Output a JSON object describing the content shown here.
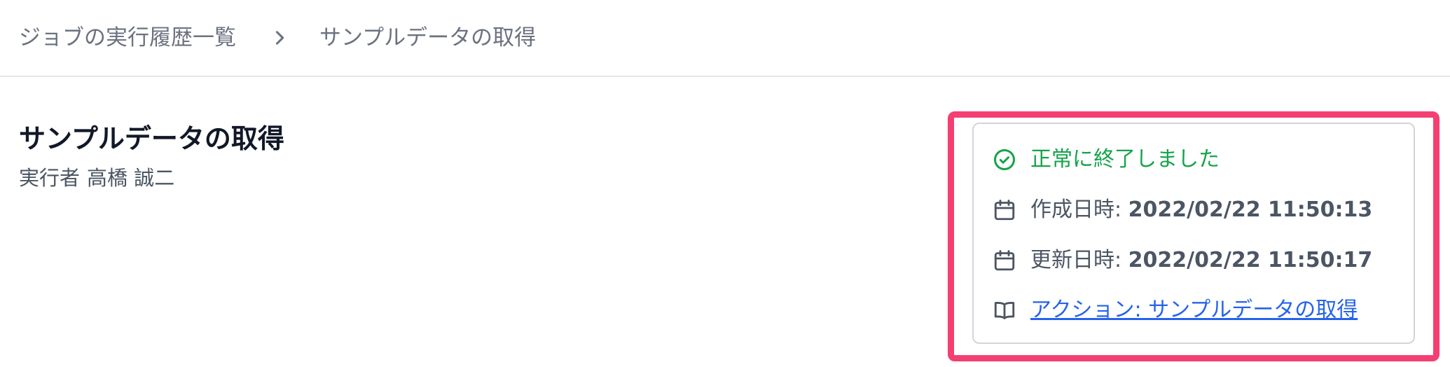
{
  "breadcrumb": {
    "parent_label": "ジョブの実行履歴一覧",
    "current_label": "サンプルデータの取得"
  },
  "header": {
    "title": "サンプルデータの取得",
    "executor_label": "実行者",
    "executor_name": "高橋 誠二"
  },
  "info_card": {
    "status": "正常に終了しました",
    "created_label": "作成日時:",
    "created_value": "2022/02/22 11:50:13",
    "updated_label": "更新日時:",
    "updated_value": "2022/02/22 11:50:17",
    "action_link": "アクション: サンプルデータの取得"
  },
  "colors": {
    "success": "#16a34a",
    "link": "#2563eb",
    "highlight": "#f43f73",
    "muted_text": "#6b7280"
  },
  "icons": {
    "separator": "chevron-right-icon",
    "status": "check-circle-icon",
    "created": "calendar-icon",
    "updated": "calendar-icon",
    "action": "book-open-icon"
  }
}
